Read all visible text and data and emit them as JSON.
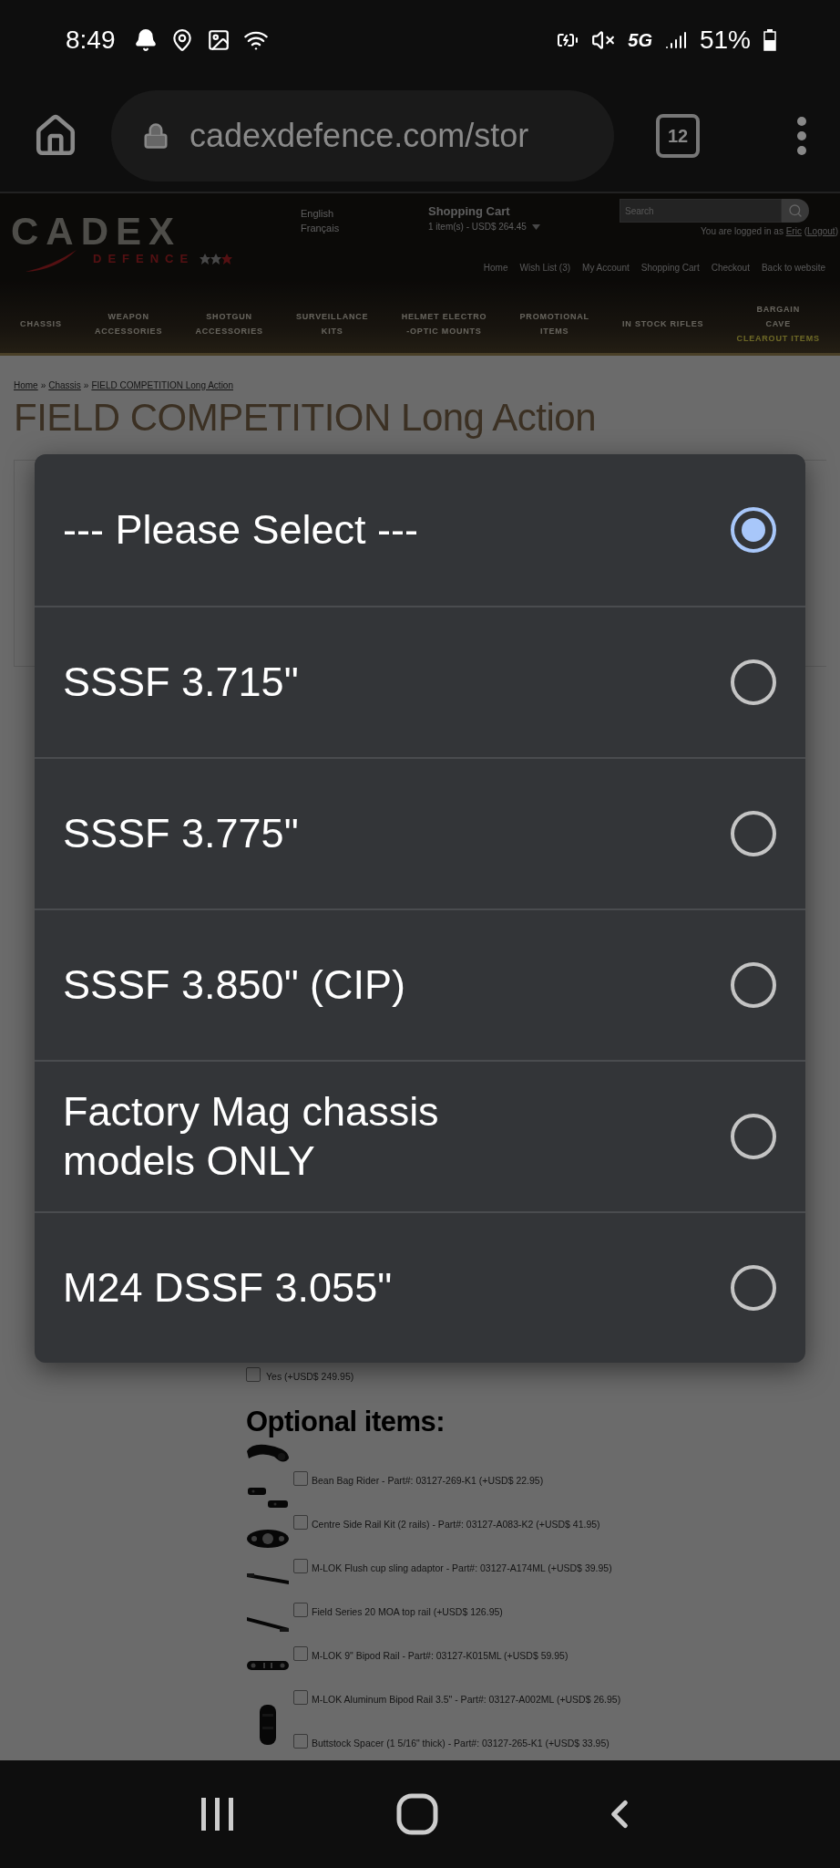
{
  "status_bar": {
    "time": "8:49",
    "network": "5G",
    "battery": "51%"
  },
  "browser": {
    "url": "cadexdefence.com/stor",
    "tab_count": "12"
  },
  "site_header": {
    "logo": {
      "word": "CADEX",
      "subword": "DEFENCE"
    },
    "languages": [
      "English",
      "Français"
    ],
    "cart": {
      "title": "Shopping Cart",
      "summary": "1 item(s) - USD$ 264.45"
    },
    "search": {
      "placeholder": "Search"
    },
    "login": {
      "prefix": "You are logged in as",
      "user": "Eric",
      "open": "(",
      "logout": "Logout",
      "close": ")"
    },
    "top_links": [
      "Home",
      "Wish List (3)",
      "My Account",
      "Shopping Cart",
      "Checkout",
      "Back to website"
    ],
    "categories": [
      {
        "lines": [
          "CHASSIS"
        ]
      },
      {
        "lines": [
          "WEAPON",
          "ACCESSORIES"
        ]
      },
      {
        "lines": [
          "SHOTGUN",
          "ACCESSORIES"
        ]
      },
      {
        "lines": [
          "SURVEILLANCE",
          "KITS"
        ]
      },
      {
        "lines": [
          "HELMET ELECTRO",
          "-OPTIC MOUNTS"
        ]
      },
      {
        "lines": [
          "PROMOTIONAL",
          "ITEMS"
        ]
      },
      {
        "lines": [
          "IN STOCK RIFLES"
        ]
      },
      {
        "lines": [
          "BARGAIN",
          "CAVE"
        ],
        "extra": "CLEAROUT ITEMS"
      }
    ]
  },
  "breadcrumb": [
    {
      "kind": "link",
      "text": "Home"
    },
    {
      "kind": "sep",
      "text": "»"
    },
    {
      "kind": "link",
      "text": "Chassis"
    },
    {
      "kind": "sep",
      "text": "»"
    },
    {
      "kind": "link",
      "text": "FIELD COMPETITION Long Action"
    }
  ],
  "product_title": "FIELD COMPETITION Long Action",
  "option_yes": {
    "label": "Yes (+USD$ 249.95)",
    "checked": false
  },
  "optional_items": {
    "title": "Optional items:",
    "items": [
      {
        "label": "Bean Bag Rider - Part#: 03127-269-K1 (+USD$ 22.95)",
        "checked": false
      },
      {
        "label": "Centre Side Rail Kit (2 rails) - Part#: 03127-A083-K2 (+USD$ 41.95)",
        "checked": false
      },
      {
        "label": "M-LOK Flush cup sling adaptor - Part#: 03127-A174ML (+USD$ 39.95)",
        "checked": false
      },
      {
        "label": "Field Series 20 MOA top rail (+USD$ 126.95)",
        "checked": false
      },
      {
        "label": "M-LOK 9\" Bipod Rail - Part#: 03127-K015ML (+USD$ 59.95)",
        "checked": false
      },
      {
        "label": "M-LOK Aluminum Bipod Rail 3.5\" - Part#: 03127-A002ML (+USD$ 26.95)",
        "checked": false
      },
      {
        "label": "Buttstock Spacer (1 5/16\" thick) - Part#: 03127-265-K1 (+USD$ 33.95)",
        "checked": false
      }
    ]
  },
  "select_dialog": {
    "options": [
      {
        "label": "--- Please Select ---",
        "selected": true
      },
      {
        "label": "SSSF 3.715\"",
        "selected": false
      },
      {
        "label": "SSSF 3.775\"",
        "selected": false
      },
      {
        "label": "SSSF 3.850\" (CIP)",
        "selected": false
      },
      {
        "label": "Factory Mag chassis models ONLY",
        "selected": false
      },
      {
        "label": "M24 DSSF 3.055\"",
        "selected": false
      }
    ]
  }
}
